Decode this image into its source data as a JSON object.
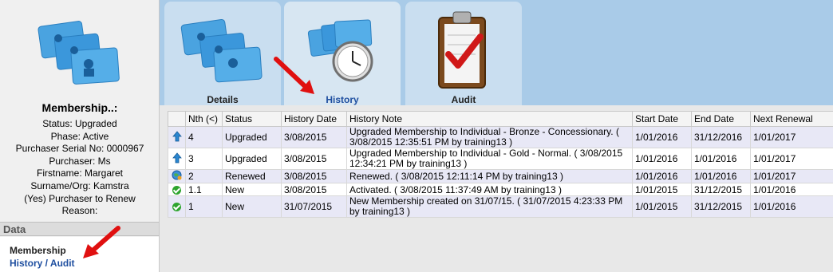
{
  "sidebar": {
    "title": "Membership..:",
    "info": [
      "Status: Upgraded",
      "Phase: Active",
      "Purchaser Serial No: 0000967",
      "Purchaser: Ms",
      "Firstname: Margaret",
      "Surname/Org: Kamstra",
      "(Yes) Purchaser to Renew",
      "Reason:"
    ],
    "data_header": "Data",
    "data_items": [
      "Membership",
      "History / Audit"
    ]
  },
  "tabs": [
    {
      "label": "Details",
      "icon": "member-cards-icon"
    },
    {
      "label": "History",
      "icon": "history-clock-icon"
    },
    {
      "label": "Audit",
      "icon": "clipboard-check-icon"
    }
  ],
  "grid": {
    "columns": [
      "",
      "Nth (<)",
      "Status",
      "History Date",
      "History Note",
      "Start Date",
      "End Date",
      "Next Renewal"
    ],
    "rows": [
      {
        "icon": "upgrade-arrow-icon",
        "nth": "4",
        "status": "Upgraded",
        "date": "3/08/2015",
        "note": "Upgraded Membership to Individual - Bronze - Concessionary. ( 3/08/2015 12:35:51 PM by training13 )",
        "start": "1/01/2016",
        "end": "31/12/2016",
        "renewal": "1/01/2017"
      },
      {
        "icon": "upgrade-arrow-icon",
        "nth": "3",
        "status": "Upgraded",
        "date": "3/08/2015",
        "note": "Upgraded Membership to Individual - Gold - Normal. ( 3/08/2015 12:34:21 PM by training13 )",
        "start": "1/01/2016",
        "end": "1/01/2016",
        "renewal": "1/01/2017"
      },
      {
        "icon": "renew-globe-icon",
        "nth": "2",
        "status": "Renewed",
        "date": "3/08/2015",
        "note": "Renewed. ( 3/08/2015 12:11:14 PM by training13 )",
        "start": "1/01/2016",
        "end": "1/01/2016",
        "renewal": "1/01/2017"
      },
      {
        "icon": "check-circle-icon",
        "nth": "1.1",
        "status": "New",
        "date": "3/08/2015",
        "note": "Activated. ( 3/08/2015 11:37:49 AM by training13 )",
        "start": "1/01/2015",
        "end": "31/12/2015",
        "renewal": "1/01/2016"
      },
      {
        "icon": "check-circle-icon",
        "nth": "1",
        "status": "New",
        "date": "31/07/2015",
        "note": "New Membership created on 31/07/15. ( 31/07/2015 4:23:33 PM by training13 )",
        "start": "1/01/2015",
        "end": "31/12/2015",
        "renewal": "1/01/2016"
      }
    ]
  },
  "colors": {
    "tab_strip": "#a9cbe8",
    "active_tab_label": "#1f4fa0",
    "alt_row": "#e8e8f6",
    "annotation_arrow": "#e01010"
  }
}
